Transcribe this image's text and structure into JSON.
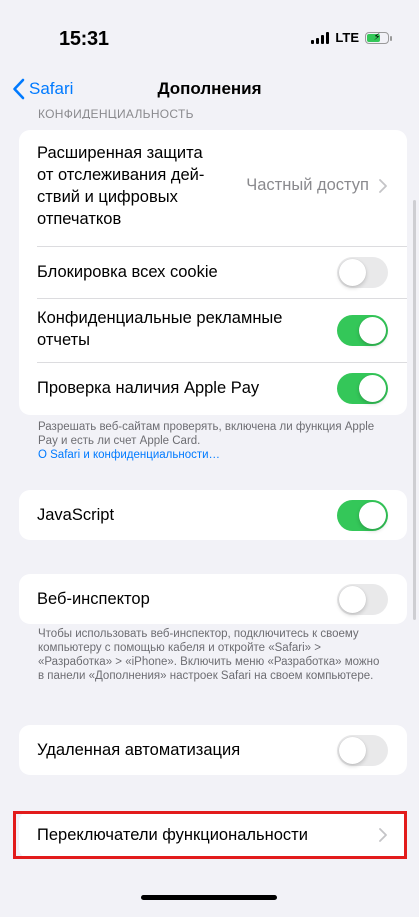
{
  "status_bar": {
    "time": "15:31",
    "network": "LTE"
  },
  "nav": {
    "back_label": "Safari",
    "title": "Дополнения"
  },
  "privacy_section": {
    "header": "КОНФИДЕНЦИАЛЬНОСТЬ",
    "tracking_protection": {
      "label": "Расширенная защита от отслеживания дей-ствий и цифровых отпечатков",
      "value": "Частный доступ"
    },
    "block_cookies": {
      "label": "Блокировка всех cookie",
      "enabled": false
    },
    "private_ad_reports": {
      "label": "Конфиденциальные рекламные отчеты",
      "enabled": true
    },
    "apple_pay_check": {
      "label": "Проверка наличия Apple Pay",
      "enabled": true
    },
    "footer_text": "Разрешать веб-сайтам проверять, включена ли функция Apple Pay и есть ли счет Apple Card.",
    "footer_link": "О Safari и конфиденциальности…"
  },
  "javascript": {
    "label": "JavaScript",
    "enabled": true
  },
  "web_inspector": {
    "label": "Веб-инспектор",
    "enabled": false,
    "footer_text": "Чтобы использовать веб-инспектор, подключитесь к своему компьютеру с помощью кабеля и откройте «Safari» > «Разработка» > «iPhone». Включить меню «Разработка» можно в панели «Дополнения» настроек Safari на своем компьютере."
  },
  "remote_automation": {
    "label": "Удаленная автоматизация",
    "enabled": false
  },
  "feature_flags": {
    "label": "Переключатели функциональности"
  },
  "colors": {
    "accent": "#007aff",
    "toggle_on": "#34c759",
    "toggle_off": "#e9e9ea",
    "highlight": "#e21b1b"
  }
}
